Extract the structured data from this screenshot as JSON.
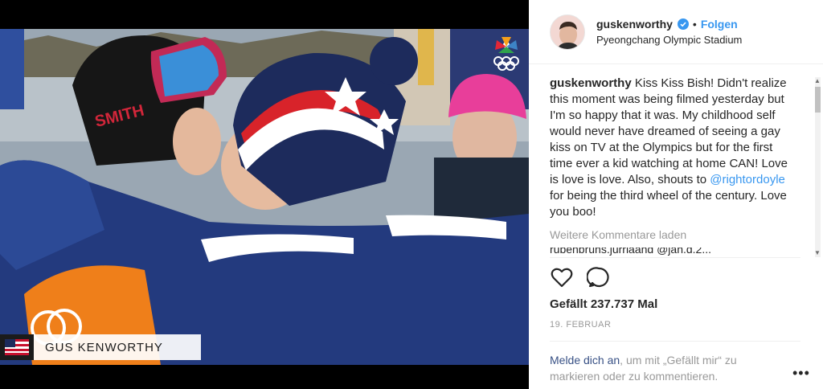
{
  "post": {
    "overlay_name": "GUS KENWORTHY"
  },
  "header": {
    "username": "guskenworthy",
    "separator": "•",
    "follow_label": "Folgen",
    "location": "Pyeongchang Olympic Stadium"
  },
  "caption": {
    "username": "guskenworthy",
    "text_before_mention": "Kiss Kiss Bish! Didn't realize this moment was being filmed yesterday but I'm so happy that it was. My childhood self would never have dreamed of seeing a gay kiss on TV at the Olympics but for the first time ever a kid watching at home CAN! Love is love is love. Also, shouts to ",
    "mention": "@rightordoyle",
    "text_after_mention": " for being the third wheel of the century. Love you boo!"
  },
  "comments": {
    "load_more": "Weitere Kommentare laden",
    "partial_comment": "rubenbruns.jurriaand @jan.d.2..."
  },
  "actions": {
    "like_icon": "heart-outline-icon",
    "comment_icon": "speech-bubble-icon"
  },
  "likes_text": "Gefällt 237.737 Mal",
  "date_text": "19. FEBRUAR",
  "login": {
    "link": "Melde dich an",
    "rest": ", um mit „Gefällt mir“ zu markieren oder zu kommentieren."
  },
  "more_label": "•••",
  "colors": {
    "link_blue": "#3897f0",
    "verified_blue": "#3897f0",
    "muted_text": "#999999",
    "text": "#262626"
  }
}
